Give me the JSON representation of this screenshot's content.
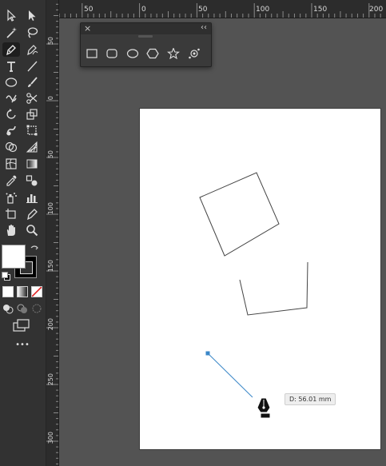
{
  "rulers": {
    "horizontal_labels": [
      "50",
      "0",
      "50",
      "100",
      "150",
      "200"
    ],
    "vertical_labels": [
      "50",
      "0",
      "50",
      "100",
      "150",
      "200",
      "250",
      "300"
    ]
  },
  "shapes_panel": {
    "close_glyph": "×",
    "collapse_glyph": "‹‹",
    "items": [
      "rectangle-icon",
      "rounded-rectangle-icon",
      "ellipse-icon",
      "polygon-icon",
      "star-icon",
      "flare-icon"
    ]
  },
  "tools": {
    "selection": "selection-tool-icon",
    "direct_selection": "direct-selection-tool-icon",
    "magic_wand": "magic-wand-tool-icon",
    "lasso": "lasso-tool-icon",
    "pen": "pen-tool-icon",
    "curvature": "curvature-tool-icon",
    "type": "type-tool-icon",
    "line_segment": "line-segment-tool-icon",
    "ellipse": "ellipse-tool-icon",
    "paintbrush": "paintbrush-tool-icon",
    "shaper": "shaper-tool-icon",
    "scissors": "scissors-tool-icon",
    "rotate": "rotate-tool-icon",
    "scale": "scale-tool-icon",
    "warp": "warp-tool-icon",
    "free_transform": "free-transform-tool-icon",
    "shape_builder": "shape-builder-tool-icon",
    "perspective_grid": "perspective-grid-tool-icon",
    "mesh": "mesh-tool-icon",
    "gradient": "gradient-tool-icon",
    "eyedropper": "eyedropper-tool-icon",
    "blend": "blend-tool-icon",
    "symbol_sprayer": "symbol-sprayer-tool-icon",
    "column_graph": "column-graph-tool-icon",
    "artboard": "artboard-tool-icon",
    "slice": "slice-tool-icon",
    "hand": "hand-tool-icon",
    "zoom": "zoom-tool-icon",
    "more_tools": "•••"
  },
  "colors": {
    "fill": "#ffffff",
    "stroke": "#000000",
    "panel_bg": "#323232",
    "canvas_bg": "#535353",
    "path_color": "#3a87c8"
  },
  "canvas": {
    "distance_tooltip": "D: 56.01 mm"
  }
}
